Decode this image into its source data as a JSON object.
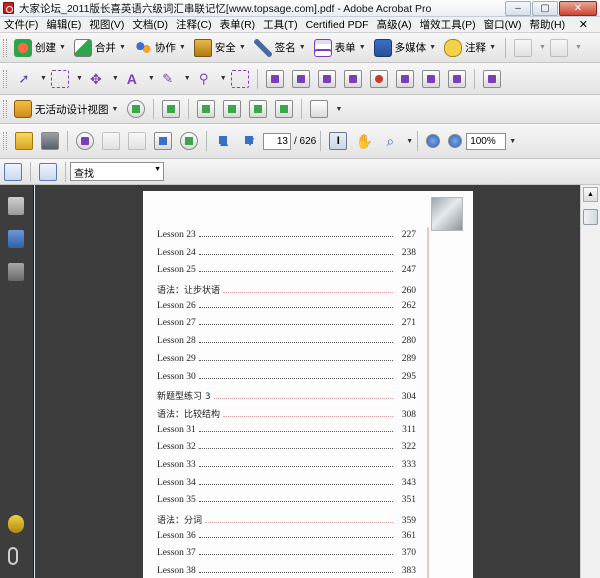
{
  "window": {
    "title": "大家论坛_2011版长喜英语六级词汇串联记忆[www.topsage.com].pdf - Adobe Acrobat Pro",
    "minimize": "–",
    "maximize": "▢",
    "close": "✕"
  },
  "menubar": {
    "items": [
      "文件(F)",
      "编辑(E)",
      "视图(V)",
      "文档(D)",
      "注释(C)",
      "表单(R)",
      "工具(T)",
      "Certified PDF",
      "高级(A)",
      "增效工具(P)",
      "窗口(W)",
      "帮助(H)"
    ],
    "close": "✕"
  },
  "toolbar1": {
    "create": "创建",
    "combine": "合并",
    "collaborate": "协作",
    "secure": "安全",
    "sign": "签名",
    "forms": "表单",
    "multimedia": "多媒体",
    "comment": "注释"
  },
  "toolbar3": {
    "design_view": "无活动设计视图"
  },
  "navigation": {
    "current_page": "13",
    "total_pages": "/ 626",
    "zoom": "100%"
  },
  "find": {
    "placeholder": "查找"
  },
  "document": {
    "toc": [
      {
        "label": "Lesson 23",
        "page": "227",
        "cn": false
      },
      {
        "label": "Lesson 24",
        "page": "238",
        "cn": false
      },
      {
        "label": "Lesson 25",
        "page": "247",
        "cn": false
      },
      {
        "label": "语法：让步状语",
        "page": "260",
        "cn": true
      },
      {
        "label": "Lesson 26",
        "page": "262",
        "cn": false
      },
      {
        "label": "Lesson 27",
        "page": "271",
        "cn": false
      },
      {
        "label": "Lesson 28",
        "page": "280",
        "cn": false
      },
      {
        "label": "Lesson 29",
        "page": "289",
        "cn": false
      },
      {
        "label": "Lesson 30",
        "page": "295",
        "cn": false
      },
      {
        "label": "新题型练习 3",
        "page": "304",
        "cn": true
      },
      {
        "label": "语法：比较结构",
        "page": "308",
        "cn": true
      },
      {
        "label": "Lesson 31",
        "page": "311",
        "cn": false
      },
      {
        "label": "Lesson 32",
        "page": "322",
        "cn": false
      },
      {
        "label": "Lesson 33",
        "page": "333",
        "cn": false
      },
      {
        "label": "Lesson 34",
        "page": "343",
        "cn": false
      },
      {
        "label": "Lesson 35",
        "page": "351",
        "cn": false
      },
      {
        "label": "语法：分词",
        "page": "359",
        "cn": true
      },
      {
        "label": "Lesson 36",
        "page": "361",
        "cn": false
      },
      {
        "label": "Lesson 37",
        "page": "370",
        "cn": false
      },
      {
        "label": "Lesson 38",
        "page": "383",
        "cn": false
      }
    ]
  }
}
